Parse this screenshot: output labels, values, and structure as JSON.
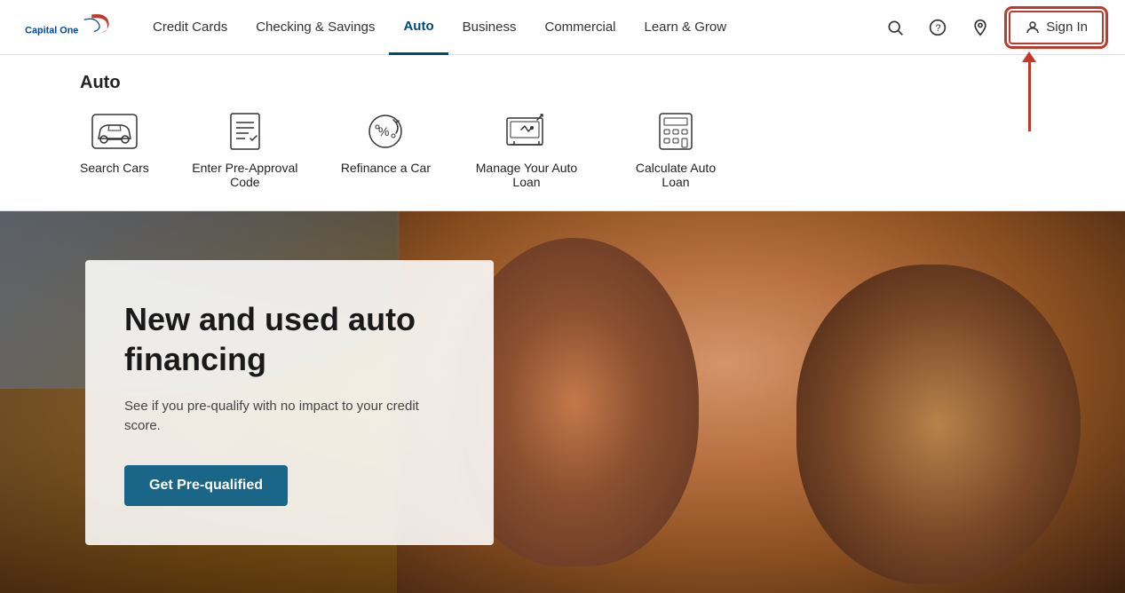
{
  "header": {
    "logo_alt": "Capital One",
    "nav": [
      {
        "label": "Credit Cards",
        "id": "credit-cards",
        "active": false
      },
      {
        "label": "Checking & Savings",
        "id": "checking-savings",
        "active": false
      },
      {
        "label": "Auto",
        "id": "auto",
        "active": true
      },
      {
        "label": "Business",
        "id": "business",
        "active": false
      },
      {
        "label": "Commercial",
        "id": "commercial",
        "active": false
      },
      {
        "label": "Learn & Grow",
        "id": "learn-grow",
        "active": false
      }
    ],
    "icons": {
      "search": "search-icon",
      "help": "help-icon",
      "location": "location-icon"
    },
    "sign_in_label": "Sign In"
  },
  "auto_section": {
    "title": "Auto",
    "nav_items": [
      {
        "label": "Search Cars",
        "id": "search-cars"
      },
      {
        "label": "Enter Pre-Approval Code",
        "id": "pre-approval"
      },
      {
        "label": "Refinance a Car",
        "id": "refinance"
      },
      {
        "label": "Manage Your Auto Loan",
        "id": "manage-loan"
      },
      {
        "label": "Calculate Auto Loan",
        "id": "calculate"
      }
    ]
  },
  "hero": {
    "title": "New and used auto financing",
    "subtitle": "See if you pre-qualify with no impact to your credit score.",
    "cta_label": "Get Pre-qualified"
  }
}
